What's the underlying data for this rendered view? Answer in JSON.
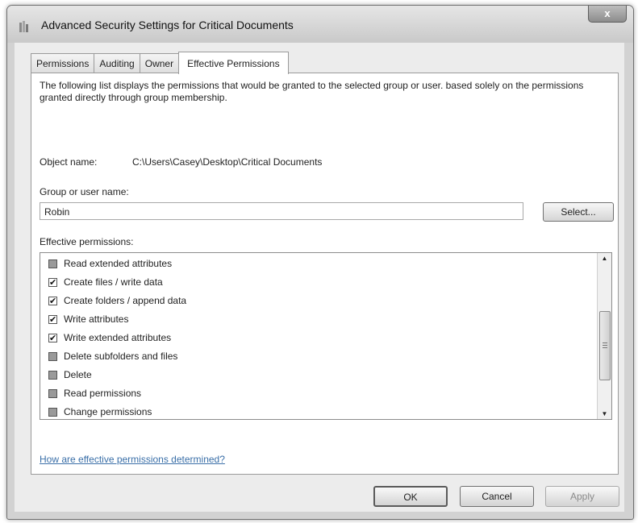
{
  "window": {
    "title": "Advanced Security Settings for Critical Documents",
    "close_label": "x"
  },
  "tabs": [
    {
      "label": "Permissions",
      "active": false
    },
    {
      "label": "Auditing",
      "active": false
    },
    {
      "label": "Owner",
      "active": false
    },
    {
      "label": "Effective Permissions",
      "active": true
    }
  ],
  "panel": {
    "description": "The following list displays the permissions that would be granted to the selected group or user. based solely on the permissions granted directly through group membership.",
    "object_name_label": "Object name:",
    "object_name_value": "C:\\Users\\Casey\\Desktop\\Critical Documents",
    "group_label": "Group or user name:",
    "group_value": "Robin",
    "select_button": "Select...",
    "effective_label": "Effective permissions:",
    "permissions": [
      {
        "label": "Read extended attributes",
        "checked": false
      },
      {
        "label": "Create files / write data",
        "checked": true
      },
      {
        "label": "Create folders / append data",
        "checked": true
      },
      {
        "label": "Write attributes",
        "checked": true
      },
      {
        "label": "Write extended attributes",
        "checked": true
      },
      {
        "label": "Delete subfolders and files",
        "checked": false
      },
      {
        "label": "Delete",
        "checked": false
      },
      {
        "label": "Read permissions",
        "checked": false
      },
      {
        "label": "Change permissions",
        "checked": false
      }
    ],
    "help_link": "How are effective permissions determined?"
  },
  "buttons": {
    "ok": "OK",
    "cancel": "Cancel",
    "apply": "Apply"
  },
  "colors": {
    "link": "#3a6fa8",
    "window_frame": "#d2d2d2",
    "unchecked_box": "#9a9a9a"
  }
}
